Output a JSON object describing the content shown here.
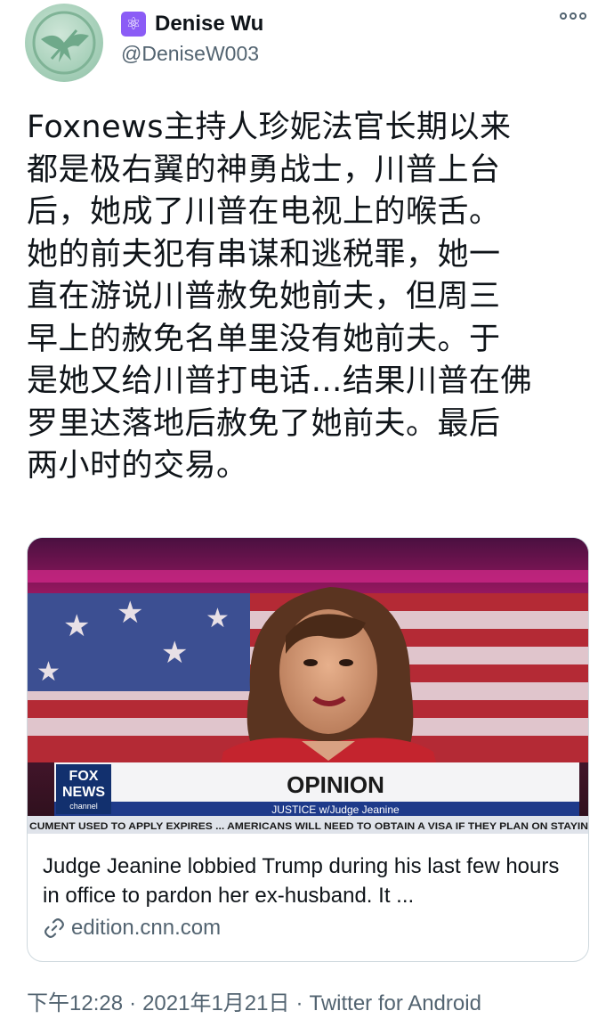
{
  "user": {
    "display_name": "Denise Wu",
    "handle": "@DeniseW003",
    "badge_icon": "atom-icon",
    "avatar_icon": "mockingjay-icon"
  },
  "more_icon": "more-options-icon",
  "tweet": {
    "text": "Foxnews主持人珍妮法官长期以来\n都是极右翼的神勇战士，川普上台\n后，她成了川普在电视上的喉舌。\n她的前夫犯有串谋和逃税罪，她一\n直在游说川普赦免她前夫，但周三\n早上的赦免名单里没有她前夫。于\n是她又给川普打电话…结果川普在佛\n罗里达落地后赦免了她前夫。最后\n两小时的交易。"
  },
  "card": {
    "media": {
      "logo_line1": "FOX",
      "logo_line2": "NEWS",
      "logo_line3": "channel",
      "banner_title": "OPINION",
      "banner_subtitle": "JUSTICE w/Judge Jeanine",
      "ticker": "CUMENT USED TO APPLY EXPIRES ... AMERICANS WILL NEED TO OBTAIN A VISA IF THEY PLAN ON STAYIN"
    },
    "title": "Judge Jeanine lobbied Trump during his last few hours in office to pardon her ex-husband. It ...",
    "domain": "edition.cnn.com",
    "link_icon": "link-icon"
  },
  "footer": {
    "time": "下午12:28",
    "separator": "·",
    "date": "2021年1月21日",
    "source": "Twitter for Android"
  },
  "colors": {
    "text_primary": "#0f1419",
    "text_secondary": "#536471",
    "badge": "#8b5cf6",
    "avatar": "#a9d1bb",
    "card_border": "#cfd9de"
  }
}
